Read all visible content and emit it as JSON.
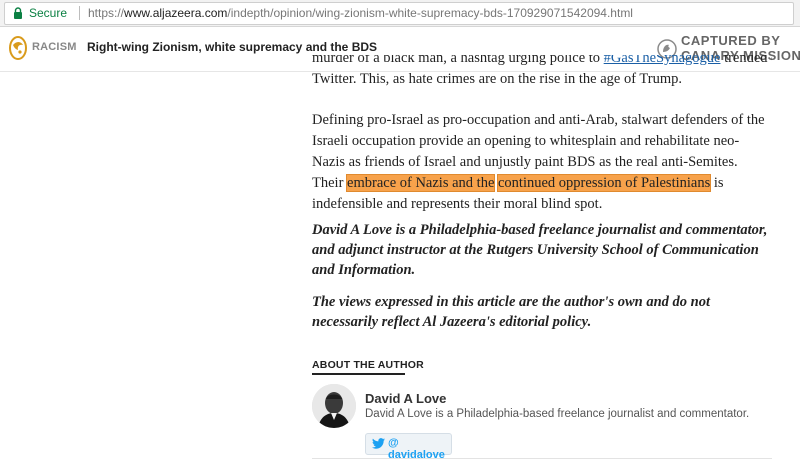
{
  "browser": {
    "secure_label": "Secure",
    "url_scheme": "https://",
    "url_domain": "www.aljazeera.com",
    "url_path": "/indepth/opinion/wing-zionism-white-supremacy-bds-170929071542094.html"
  },
  "header": {
    "section": "RACISM",
    "title": "Right-wing Zionism, white supremacy and the BDS",
    "watermark_line1": "CAPTURED BY",
    "watermark_line2": "CANARY MISSION"
  },
  "article": {
    "cut_line_start": "murder of a black man, a hashtag urging police to ",
    "cut_link": "#GasTheSynagogue",
    "cut_line_end": " trended on",
    "p1_tail": "Twitter. This, as hate crimes are on the rise in the age of Trump.",
    "p2_before": "Defining pro-Israel as pro-occupation and anti-Arab, stalwart defenders of the Israeli occupation provide an opening to whitesplain and rehabilitate neo-Nazis as friends of Israel and unjustly paint BDS as the real anti-Semites. Their ",
    "p2_highlight1": "embrace of Nazis and the",
    "p2_highlight2": "continued oppression of Palestinians",
    "p2_after": " is indefensible and represents their moral blind spot.",
    "bio_paragraph": "David A Love is a Philadelphia-based freelance journalist and commentator, and adjunct instructor at the Rutgers University School of Communication and Information.",
    "disclaimer": "The views expressed in this article are the author's own and do not necessarily reflect Al Jazeera's editorial policy."
  },
  "about": {
    "heading": "ABOUT THE AUTHOR",
    "name": "David A Love",
    "bio": "David A Love is a Philadelphia-based freelance journalist and commentator.",
    "twitter_handle": "@ davidalove"
  },
  "colors": {
    "highlight": "#f7a24b",
    "link": "#1a5fa6",
    "secure_green": "#0b8043",
    "twitter_blue": "#1da1f2",
    "aljazeera_gold": "#d99b1c"
  }
}
